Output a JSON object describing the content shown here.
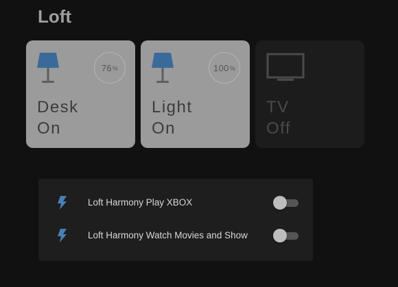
{
  "room": {
    "title": "Loft"
  },
  "tiles": [
    {
      "name": "Desk",
      "state": "On",
      "brightness": "76",
      "brightness_unit": "%",
      "icon": "lamp-icon",
      "active": true
    },
    {
      "name": "Light",
      "state": "On",
      "brightness": "100",
      "brightness_unit": "%",
      "icon": "lamp-icon",
      "active": true
    },
    {
      "name": "TV",
      "state": "Off",
      "icon": "tv-icon",
      "active": false
    }
  ],
  "activities": [
    {
      "label": "Loft Harmony Play XBOX",
      "icon": "lightning-bolt-icon",
      "enabled": false
    },
    {
      "label": "Loft Harmony Watch Movies and Show",
      "icon": "lightning-bolt-icon",
      "enabled": false
    }
  ],
  "colors": {
    "background": "#111111",
    "tile_on": "#9b9b9b",
    "tile_off": "#1c1c1c",
    "lamp_shade": "#3a6a9a",
    "bolt": "#4a7fb5",
    "panel": "#1e1e1e"
  }
}
